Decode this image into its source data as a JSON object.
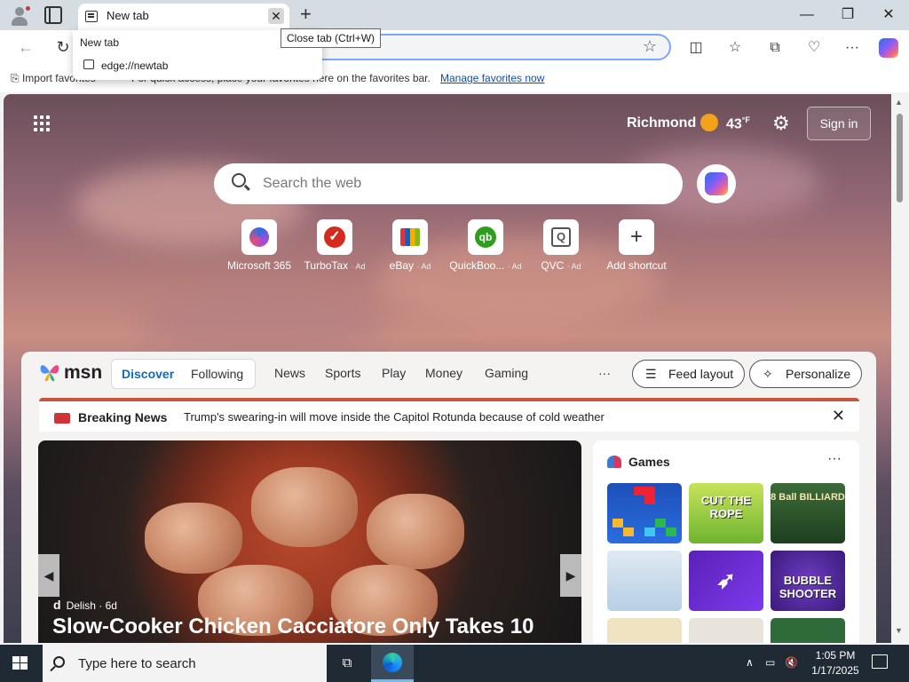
{
  "browser": {
    "tab_title": "New tab",
    "tab_close_tooltip": "Close tab (Ctrl+W)",
    "dropdown": {
      "item1": "New tab",
      "item2": "edge://newtab"
    },
    "favorites_bar": {
      "import_label": "Import favorites",
      "tip": "For quick access, place your favorites here on the favorites bar.",
      "manage_link": "Manage favorites now"
    }
  },
  "newtab": {
    "weather": {
      "city": "Richmond",
      "temp": "43",
      "unit": "°F"
    },
    "sign_in": "Sign in",
    "search_placeholder": "Search the web",
    "shortcuts": [
      {
        "label": "Microsoft 365",
        "ad": ""
      },
      {
        "label": "TurboTax",
        "ad": "· Ad"
      },
      {
        "label": "eBay",
        "ad": "· Ad"
      },
      {
        "label": "QuickBoo...",
        "ad": "· Ad"
      },
      {
        "label": "QVC",
        "ad": "· Ad"
      },
      {
        "label": "Add shortcut",
        "ad": ""
      }
    ]
  },
  "msn": {
    "logo_text": "msn",
    "tabs": {
      "discover": "Discover",
      "following": "Following"
    },
    "nav": [
      "News",
      "Sports",
      "Play",
      "Money",
      "Gaming"
    ],
    "more": "···",
    "feed_layout": "Feed layout",
    "personalize": "Personalize",
    "breaking": {
      "label": "Breaking News",
      "text": "Trump's swearing-in will move inside the Capitol Rotunda because of cold weather"
    },
    "hero": {
      "source": "Delish",
      "age": "· 6d",
      "title": "Slow-Cooker Chicken Cacciatore Only Takes 10"
    },
    "games": {
      "label": "Games",
      "tiles": [
        "",
        "CUT THE ROPE",
        "8 Ball BILLIARD",
        "",
        "",
        "BUBBLE SHOOTER"
      ]
    }
  },
  "taskbar": {
    "search_placeholder": "Type here to search",
    "time": "1:05 PM",
    "date": "1/17/2025"
  }
}
